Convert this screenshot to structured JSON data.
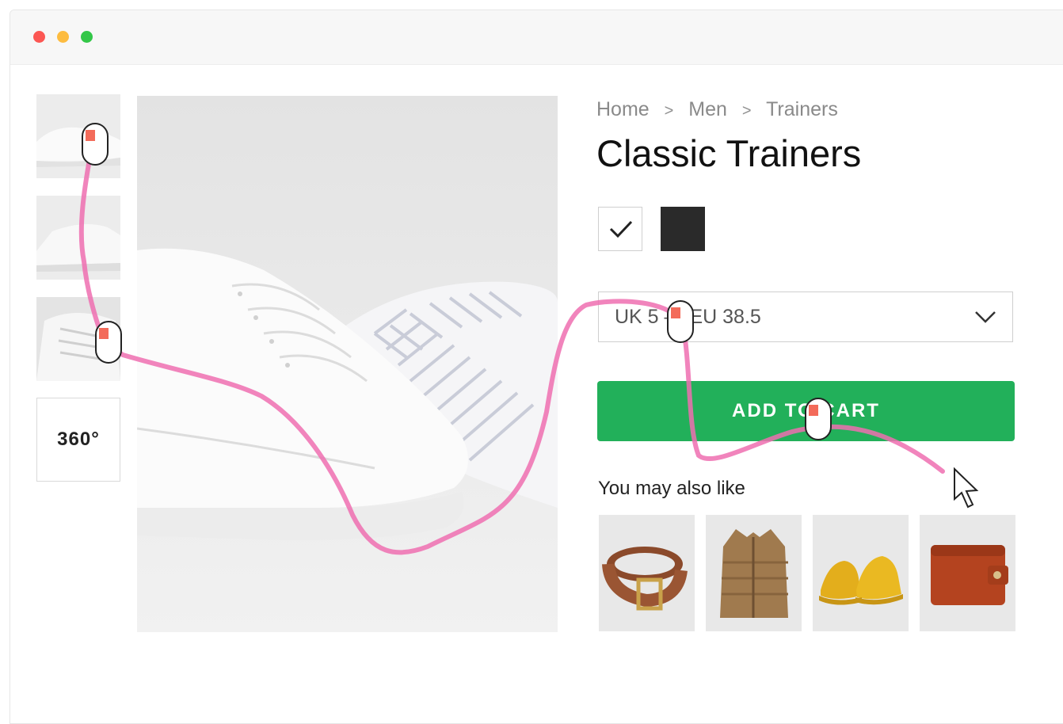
{
  "window": {
    "controls": [
      "close",
      "minimize",
      "maximize"
    ]
  },
  "gallery": {
    "thumbnails": [
      "shoe-top-view",
      "shoe-side-view",
      "shoe-laces-closeup"
    ],
    "view_360_label": "360°"
  },
  "product": {
    "breadcrumb": [
      "Home",
      "Men",
      "Trainers"
    ],
    "breadcrumb_separator": ">",
    "title": "Classic Trainers",
    "colors": [
      {
        "name": "white",
        "hex": "#ffffff",
        "selected": true
      },
      {
        "name": "black",
        "hex": "#2a2a2a",
        "selected": false
      }
    ],
    "size_selected": "UK 5 — EU 38.5",
    "add_to_cart_label": "ADD TO CART",
    "also_like_heading": "You may also like",
    "recommendations": [
      "belt",
      "vest",
      "yellow-shoes",
      "wallet"
    ]
  },
  "colors": {
    "cart_button": "#22b05a",
    "mouse_path": "#ef6fb0",
    "click_marker": "#f36b5a"
  }
}
